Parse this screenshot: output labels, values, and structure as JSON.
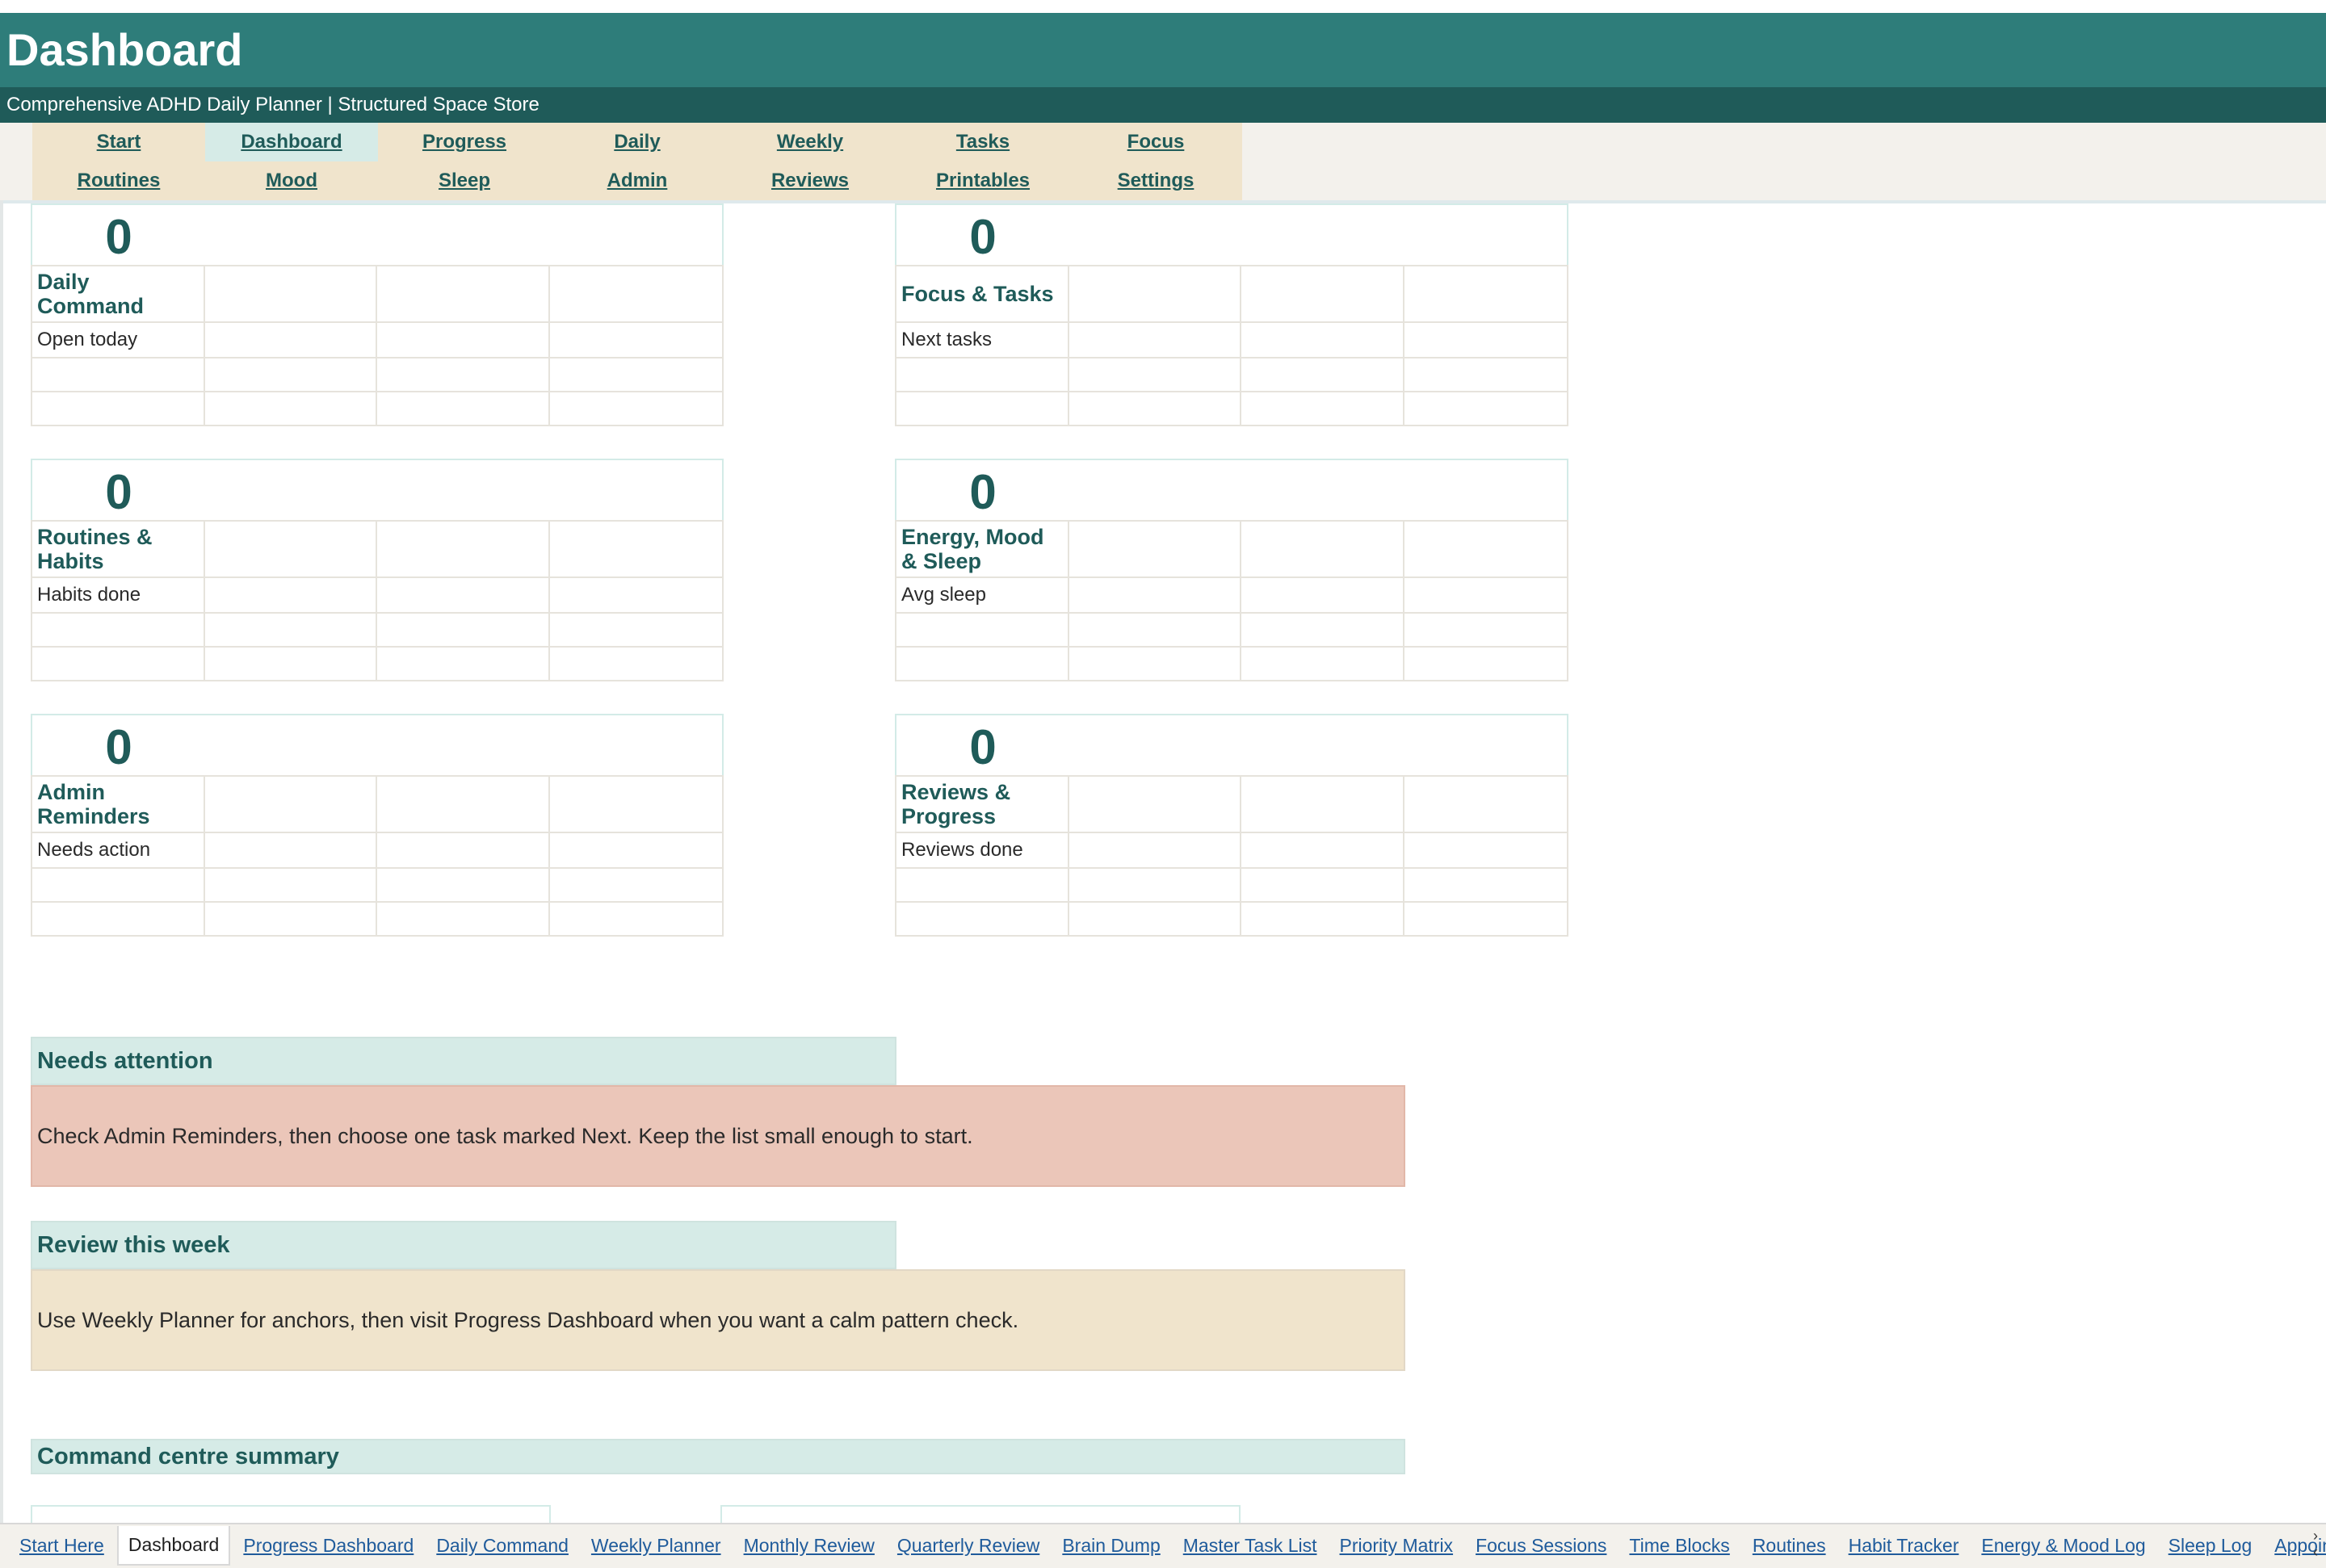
{
  "header": {
    "title": "Dashboard",
    "subtitle": "Comprehensive ADHD Daily Planner | Structured Space Store"
  },
  "nav": {
    "row1": [
      "Start",
      "Dashboard",
      "Progress",
      "Daily",
      "Weekly",
      "Tasks",
      "Focus"
    ],
    "row2": [
      "Routines",
      "Mood",
      "Sleep",
      "Admin",
      "Reviews",
      "Printables",
      "Settings"
    ],
    "active": "Dashboard"
  },
  "cards": [
    {
      "value": "0",
      "label": "Daily Command",
      "metric": "Open today"
    },
    {
      "value": "0",
      "label": "Focus & Tasks",
      "metric": "Next tasks"
    },
    {
      "value": "0",
      "label": "Routines & Habits",
      "metric": "Habits done"
    },
    {
      "value": "0",
      "label": "Energy, Mood & Sleep",
      "metric": "Avg sleep"
    },
    {
      "value": "0",
      "label": "Admin Reminders",
      "metric": "Needs action"
    },
    {
      "value": "0",
      "label": "Reviews & Progress",
      "metric": "Reviews done"
    }
  ],
  "needs_attention": {
    "title": "Needs attention",
    "text": "Check Admin Reminders, then choose one task marked Next. Keep the list small enough to start."
  },
  "review_week": {
    "title": "Review this week",
    "text": "Use Weekly Planner for anchors, then visit Progress Dashboard when you want a calm pattern check."
  },
  "command_summary": {
    "title": "Command centre summary"
  },
  "sheet_tabs": [
    "Start Here",
    "Dashboard",
    "Progress Dashboard",
    "Daily Command",
    "Weekly Planner",
    "Monthly Review",
    "Quarterly Review",
    "Brain Dump",
    "Master Task List",
    "Priority Matrix",
    "Focus Sessions",
    "Time Blocks",
    "Routines",
    "Habit Tracker",
    "Energy & Mood Log",
    "Sleep Log",
    "Appointments"
  ],
  "active_sheet": "Dashboard",
  "colors": {
    "header": "#2e7d7a",
    "subheader": "#1f5b59",
    "nav": "#f0e4cc",
    "accent": "#d6ebe7",
    "attention": "#ebc6b9"
  }
}
